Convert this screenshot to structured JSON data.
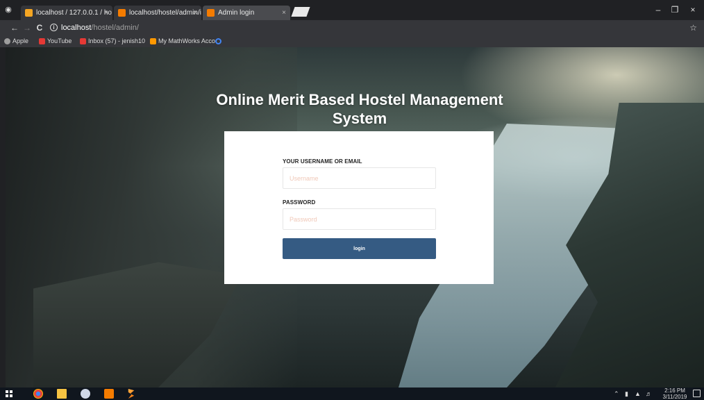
{
  "browser": {
    "tabs": [
      {
        "title": "localhost / 127.0.0.1 / ho",
        "favicon_color": "#f5a623",
        "active": false
      },
      {
        "title": "localhost/hostel/admin/i",
        "favicon_color": "#f57c00",
        "active": false
      },
      {
        "title": "Admin login",
        "favicon_color": "#f57c00",
        "active": true
      }
    ],
    "tab_close_glyph": "×",
    "window_controls": {
      "minimize": "–",
      "maximize": "❐",
      "close": "×"
    },
    "nav": {
      "back": "←",
      "forward": "→",
      "reload": "C"
    },
    "address": {
      "host": "localhost",
      "path": "/hostel/admin/"
    },
    "bookmarks": [
      {
        "label": "Apple",
        "icon_color": "#9e9e9e"
      },
      {
        "label": "YouTube",
        "icon_color": "#e53935"
      },
      {
        "label": "Inbox (57) - jenish10",
        "icon_color": "#e53935"
      },
      {
        "label": "My MathWorks Acco",
        "icon_color": "#ff9800"
      },
      {
        "label": "",
        "icon_color": "#4285f4"
      }
    ]
  },
  "page": {
    "heading": "Online Merit Based Hostel Management System",
    "form": {
      "username_label": "YOUR USERNAME OR EMAIL",
      "username_placeholder": "Username",
      "username_value": "",
      "password_label": "PASSWORD",
      "password_placeholder": "Password",
      "password_value": "",
      "submit_label": "login"
    }
  },
  "taskbar": {
    "time": "2:16 PM",
    "date": "3/11/2019",
    "apps": [
      {
        "name": "chrome-icon",
        "color": "#e8453c"
      },
      {
        "name": "file-explorer-icon",
        "color": "#f6c342"
      },
      {
        "name": "media-icon",
        "color": "#d0d8e8"
      },
      {
        "name": "xampp-icon",
        "color": "#f57c00"
      },
      {
        "name": "sublime-icon",
        "color": "#ff9800"
      }
    ]
  }
}
